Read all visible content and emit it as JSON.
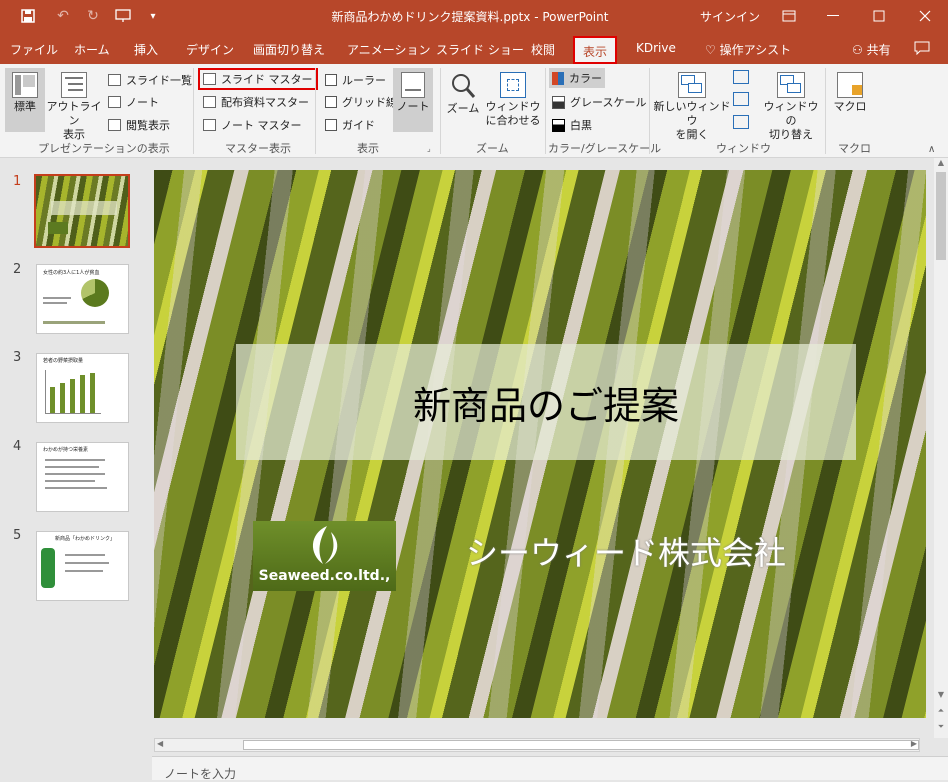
{
  "window": {
    "title": "新商品わかめドリンク提案資料.pptx  -  PowerPoint",
    "signin": "サインイン"
  },
  "menu": {
    "tabs": [
      "ファイル",
      "ホーム",
      "挿入",
      "デザイン",
      "画面切り替え",
      "アニメーション",
      "スライド ショー",
      "校閲",
      "表示",
      "KDrive"
    ],
    "tell_me": "操作アシスト",
    "share": "共有"
  },
  "ribbon": {
    "presentation_views": {
      "label": "プレゼンテーションの表示",
      "normal": "標準",
      "outline": "アウトライン\n表示",
      "slide_sorter": "スライド一覧",
      "notes_page": "ノート",
      "reading_view": "閲覧表示"
    },
    "master_views": {
      "label": "マスター表示",
      "slide_master": "スライド マスター",
      "handout_master": "配布資料マスター",
      "notes_master": "ノート マスター"
    },
    "show": {
      "label": "表示",
      "ruler": "ルーラー",
      "gridlines": "グリッド線",
      "guides": "ガイド",
      "notes": "ノート"
    },
    "zoom": {
      "label": "ズーム",
      "zoom": "ズーム",
      "fit": "ウィンドウ\nに合わせる"
    },
    "color": {
      "label": "カラー/グレースケール",
      "color": "カラー",
      "grayscale": "グレースケール",
      "bw": "白黒"
    },
    "window": {
      "label": "ウィンドウ",
      "new_window": "新しいウィンドウ\nを開く",
      "switch": "ウィンドウの\n切り替え"
    },
    "macros": {
      "label": "マクロ",
      "macros": "マクロ"
    }
  },
  "slides": {
    "numbers": [
      "1",
      "2",
      "3",
      "4",
      "5"
    ],
    "thumb2_title": "女性の約3人に1人が貧血",
    "thumb3_title": "若者の野菜摂取量",
    "thumb4_title": "わかめが持つ栄養素",
    "thumb5_title": "新商品「わかめドリンク」"
  },
  "current_slide": {
    "title": "新商品のご提案",
    "logo_text": "Seaweed.co.ltd.,",
    "company": "シーウィード株式会社"
  },
  "notes_placeholder": "ノートを入力",
  "colors": {
    "accent": "#b7472a",
    "highlight": "#e00000"
  }
}
